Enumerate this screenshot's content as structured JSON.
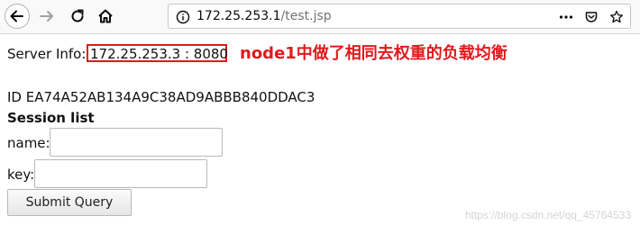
{
  "browser": {
    "url_host": "172.25.253.1",
    "url_path": "/test.jsp",
    "icons": {
      "back": "arrow-left-icon",
      "forward": "arrow-right-icon",
      "reload": "reload-icon",
      "home": "home-icon",
      "info": "info-icon",
      "more": "more-dots-icon",
      "pocket": "pocket-icon",
      "bookmark": "star-icon"
    }
  },
  "page": {
    "server_info_label": "Server Info:",
    "server_info_value": "172.25.253.3 : 8080",
    "annotation": "node1中做了相同去权重的负载均衡",
    "session_id": "ID EA74A52AB134A9C38AD9ABBB840DDAC3",
    "session_list_heading": "Session list",
    "name_label": "name:",
    "name_value": "",
    "key_label": "key:",
    "key_value": "",
    "submit_label": "Submit Query"
  },
  "watermark": "https://blog.csdn.net/qq_45764533",
  "colors": {
    "annotation": "#e0191c",
    "highlight_box": "#e0191c"
  }
}
